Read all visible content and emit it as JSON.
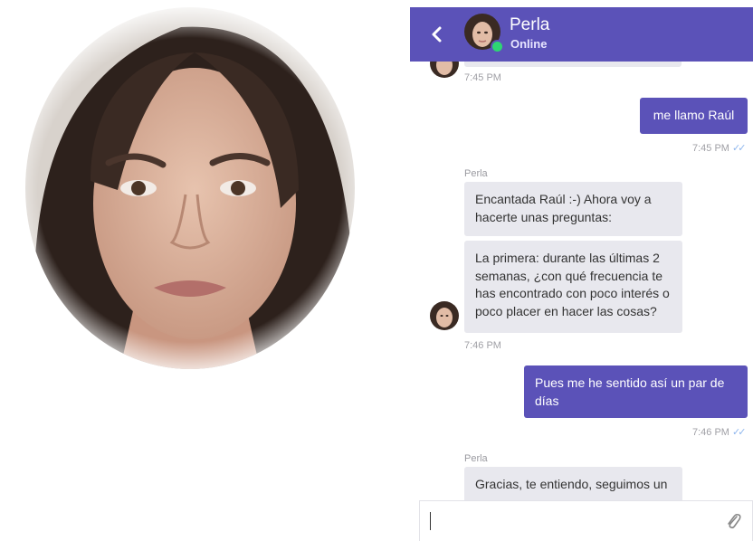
{
  "header": {
    "back_icon": "chevron-left-icon",
    "contact_name": "Perla",
    "status": "Online",
    "status_color": "#2ed573",
    "brand_color": "#5b52b8"
  },
  "messages": [
    {
      "id": "m0",
      "from": "bot",
      "time": "7:45 PM"
    },
    {
      "id": "m1",
      "from": "user",
      "text": "me llamo Raúl",
      "time": "7:45 PM",
      "read": true
    },
    {
      "id": "m2",
      "from": "bot",
      "sender": "Perla",
      "bubbles": [
        "Encantada Raúl :-) Ahora voy a hacerte unas preguntas:",
        "La primera: durante las últimas 2 semanas, ¿con qué frecuencia te has encontrado con poco interés o poco placer en hacer las cosas?"
      ],
      "time": "7:46 PM"
    },
    {
      "id": "m3",
      "from": "user",
      "text": "Pues me he sentido así un par de días",
      "time": "7:46 PM",
      "read": true
    },
    {
      "id": "m4",
      "from": "bot",
      "sender": "Perla",
      "bubbles": [
        "Gracias, te entiendo, seguimos un"
      ]
    }
  ],
  "composer": {
    "value": "",
    "attach_icon": "paperclip-icon"
  }
}
